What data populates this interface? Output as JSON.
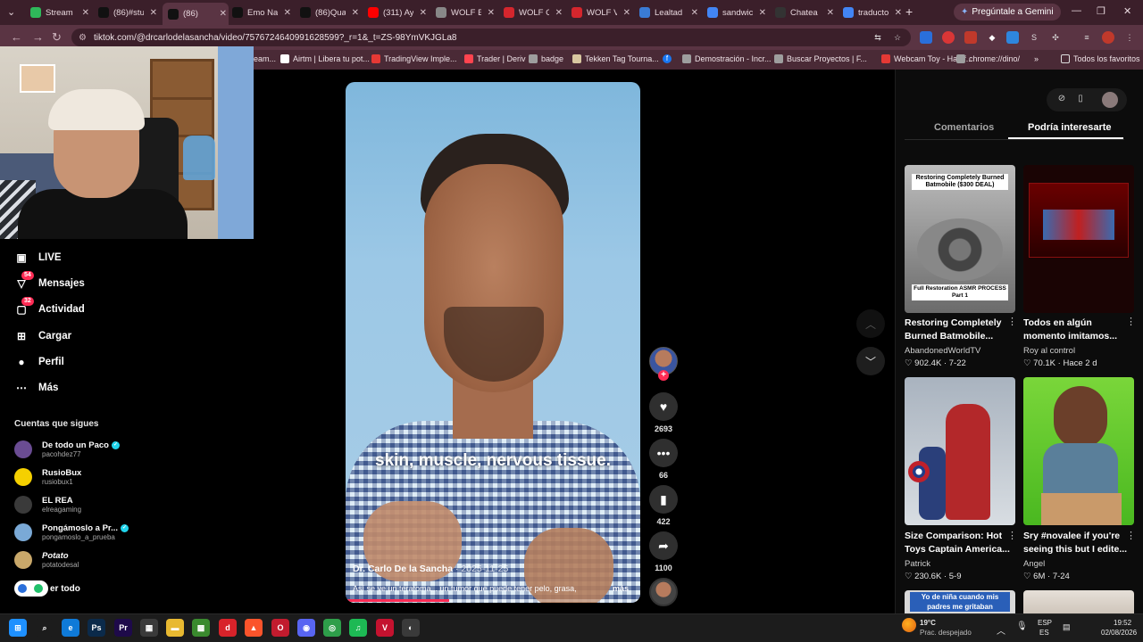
{
  "browser": {
    "tabs": [
      {
        "title": "Stream",
        "favicon": "green-check-icon",
        "color": "#2fb85a"
      },
      {
        "title": "(86)#stu",
        "favicon": "tiktok-icon",
        "color": "#111111"
      },
      {
        "title": "(86)",
        "favicon": "tiktok-icon",
        "color": "#111111"
      },
      {
        "title": "Emo Na",
        "favicon": "tiktok-icon",
        "color": "#111111"
      },
      {
        "title": "(86)Qua",
        "favicon": "tiktok-icon",
        "color": "#111111"
      },
      {
        "title": "(311) Ay",
        "favicon": "youtube-icon",
        "color": "#ff0000"
      },
      {
        "title": "WOLF E",
        "favicon": "globe-icon",
        "color": "#888888"
      },
      {
        "title": "WOLF C",
        "favicon": "shield-icon",
        "color": "#d4262d"
      },
      {
        "title": "WOLF V",
        "favicon": "shield-icon",
        "color": "#d4262d"
      },
      {
        "title": "Lealtad",
        "favicon": "diamond-icon",
        "color": "#3a7bd5"
      },
      {
        "title": "sandwic",
        "favicon": "google-icon",
        "color": "#4285f4"
      },
      {
        "title": "Chatea",
        "favicon": "c-icon",
        "color": "#333333"
      },
      {
        "title": "traducto",
        "favicon": "google-icon",
        "color": "#4285f4"
      }
    ],
    "active_tab_index": 2,
    "new_tab_label": "+",
    "gemini_label": "Pregúntale a Gemini",
    "url": "tiktok.com/@drcarlodelasancha/video/7576724640991628599?_r=1&_t=ZS-98YmVKJGLa8",
    "bookmarks": [
      {
        "label": "Airtm | Libera tu pot...",
        "color": "#ffffff"
      },
      {
        "label": "TradingView Imple...",
        "color": "#e53935"
      },
      {
        "label": "Trader | Deriv",
        "color": "#ff444f"
      },
      {
        "label": "badge",
        "color": "#9e9e9e"
      },
      {
        "label": "Tekken Tag Tourna...",
        "color": "#d8c7a0"
      },
      {
        "label": "Demostración - Incr...",
        "color": "#9e9e9e"
      },
      {
        "label": "Buscar Proyectos | F...",
        "color": "#9e9e9e"
      },
      {
        "label": "Webcam Toy - Haz f...",
        "color": "#e53935"
      },
      {
        "label": "chrome://dino/",
        "color": "#9e9e9e"
      }
    ],
    "facebook_bookmark": "f",
    "bookmarks_more": "»",
    "all_bookmarks": "Todos los favoritos",
    "bookmark_partial": "eam..."
  },
  "nav": {
    "items": [
      {
        "label": "LIVE",
        "icon": "live-icon"
      },
      {
        "label": "Mensajes",
        "icon": "message-icon",
        "badge": "54"
      },
      {
        "label": "Actividad",
        "icon": "activity-icon",
        "badge": "32"
      },
      {
        "label": "Cargar",
        "icon": "upload-icon"
      },
      {
        "label": "Perfil",
        "icon": "profile-icon"
      },
      {
        "label": "Más",
        "icon": "more-icon"
      }
    ],
    "following_title": "Cuentas que sigues",
    "following": [
      {
        "name": "De todo un Paco",
        "handle": "pacohdez77",
        "verified": true,
        "color": "#6a4c93"
      },
      {
        "name": "RusioBux",
        "handle": "rusiobux1",
        "verified": false,
        "color": "#f5d000"
      },
      {
        "name": "EL REA",
        "handle": "elreagaming",
        "verified": false,
        "color": "#3a3a3a"
      },
      {
        "name": "Pongámoslo a Pr...",
        "handle": "pongamoslo_a_prueba",
        "verified": true,
        "color": "#7aa9d6"
      },
      {
        "name": "Potato",
        "handle": "potatodesal",
        "verified": false,
        "color": "#c9a86a"
      }
    ],
    "see_all": "er todo"
  },
  "video": {
    "caption": "skin, muscle, nervous tissue.",
    "author": "Dr. Carlo De la Sancha",
    "date": "· 2025-11-25",
    "description": "Así se ve un teratoma... un tumor que puede tener pelo, grasa,",
    "more": "más",
    "progress": 0.35,
    "likes": "2693",
    "comments": "66",
    "saves": "422",
    "shares": "1100",
    "follow_plus": "+"
  },
  "panel": {
    "tabs": [
      "Comentarios",
      "Podría interesarte"
    ],
    "active_tab": 1,
    "videos": [
      {
        "title": "Restoring Completely Burned Batmobile...",
        "author": "AbandonedWorldTV",
        "likes": "902.4K",
        "date": "7-22",
        "thumb_text_top": "Restoring Completely Burned Batmobile ($300 DEAL)",
        "thumb_text_bottom": "Full Restoration ASMR PROCESS Part 1"
      },
      {
        "title": "Todos en algún momento imitamos...",
        "author": "Roy al control",
        "likes": "70.1K",
        "date": "Hace 2 d"
      },
      {
        "title": "Size Comparison: Hot Toys Captain America...",
        "author": "Patrick",
        "likes": "230.6K",
        "date": "5-9"
      },
      {
        "title": "Sry #novalee if you're seeing this but I edite...",
        "author": "Angel",
        "likes": "6M",
        "date": "7-24"
      }
    ],
    "peek_text": "Yo de niña cuando mis padres me gritaban"
  },
  "taskbar": {
    "apps": [
      {
        "name": "windows-icon",
        "color": "#1e90ff",
        "glyph": "⊞"
      },
      {
        "name": "search-icon",
        "color": "#1c1c1c",
        "glyph": "⌕"
      },
      {
        "name": "edge-icon",
        "color": "#0f7ad8",
        "glyph": "e"
      },
      {
        "name": "photoshop-icon",
        "color": "#0b2a4a",
        "glyph": "Ps"
      },
      {
        "name": "premiere-icon",
        "color": "#1e0a4a",
        "glyph": "Pr"
      },
      {
        "name": "store-icon",
        "color": "#3a3a3a",
        "glyph": "▦"
      },
      {
        "name": "folder-icon",
        "color": "#e8b931",
        "glyph": "▬"
      },
      {
        "name": "minecraft-icon",
        "color": "#3a8a2e",
        "glyph": "▩"
      },
      {
        "name": "app-red-icon",
        "color": "#d8232a",
        "glyph": "d"
      },
      {
        "name": "brave-icon",
        "color": "#fb542b",
        "glyph": "▲"
      },
      {
        "name": "opera-icon",
        "color": "#c11b2e",
        "glyph": "O"
      },
      {
        "name": "discord-icon",
        "color": "#5865f2",
        "glyph": "◉"
      },
      {
        "name": "chrome-icon",
        "color": "#2e9e4a",
        "glyph": "◎"
      },
      {
        "name": "spotify-icon",
        "color": "#1db954",
        "glyph": "♫"
      },
      {
        "name": "voicemod-icon",
        "color": "#c4122f",
        "glyph": "V"
      },
      {
        "name": "obs-icon",
        "color": "#3a3a3a",
        "glyph": "◐"
      }
    ],
    "weather_temp": "19°C",
    "weather_desc": "Prac. despejado",
    "lang_top": "ESP",
    "lang_bottom": "ES",
    "time": "19:52",
    "date": "02/08/2026"
  }
}
